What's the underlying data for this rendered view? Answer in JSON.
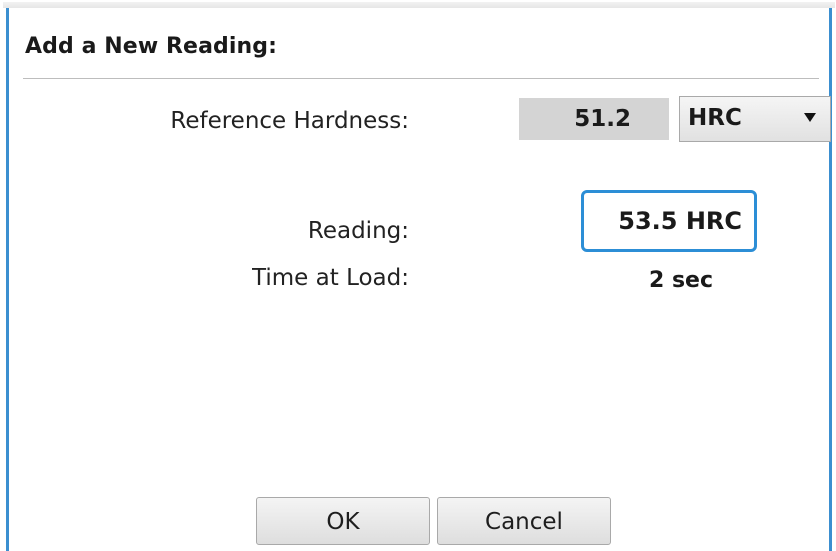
{
  "dialog": {
    "title": "Add a New Reading:"
  },
  "reference": {
    "label": "Reference Hardness:",
    "value": "51.2",
    "scale_selected": "HRC"
  },
  "reading": {
    "label": "Reading:",
    "value": "53.5 HRC"
  },
  "time_at_load": {
    "label": "Time at Load:",
    "value": "2 sec"
  },
  "buttons": {
    "ok": "OK",
    "cancel": "Cancel"
  },
  "colors": {
    "accent": "#2c8ed6",
    "reference_value_bg": "#d4d4d4"
  }
}
